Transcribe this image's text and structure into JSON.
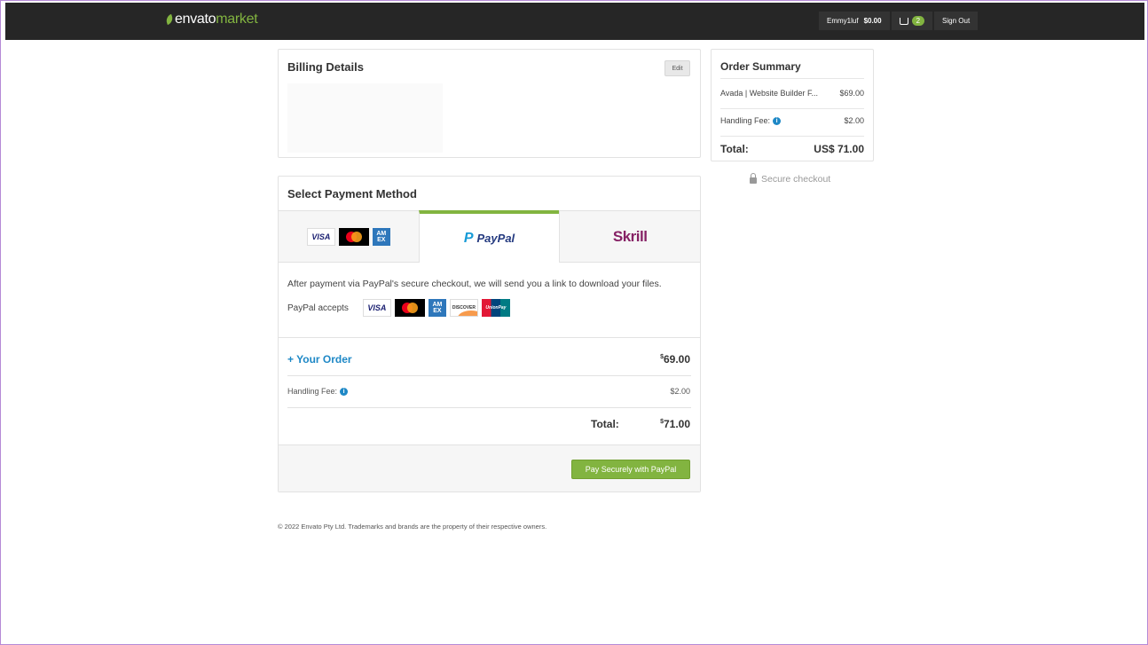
{
  "header": {
    "logo_brand": "envato",
    "logo_market": "market",
    "username": "Emmy1luf",
    "balance": "$0.00",
    "cart_count": "2",
    "signout_label": "Sign Out"
  },
  "billing": {
    "title": "Billing Details",
    "edit_label": "Edit"
  },
  "payment": {
    "title": "Select Payment Method",
    "tabs": [
      {
        "id": "cards",
        "cards": [
          "VISA",
          "MasterCard",
          "AMEX"
        ]
      },
      {
        "id": "paypal",
        "label": "PayPal",
        "active": true
      },
      {
        "id": "skrill",
        "label": "Skrill"
      }
    ],
    "paypal_info": "After payment via PayPal's secure checkout, we will send you a link to download your files.",
    "paypal_accepts_label": "PayPal accepts",
    "accepted_cards": [
      "VISA",
      "MasterCard",
      "AMEX",
      "DISCOVER",
      "UnionPay"
    ],
    "your_order_label": "+ Your Order",
    "your_order_currency": "$",
    "your_order_price": "69.00",
    "handling_fee_label": "Handling Fee:",
    "handling_fee_value": "$2.00",
    "total_label": "Total:",
    "total_currency": "$",
    "total_value": "71.00",
    "pay_button_label": "Pay Securely with PayPal"
  },
  "summary": {
    "title": "Order Summary",
    "item_name": "Avada | Website Builder F...",
    "item_price": "$69.00",
    "handling_fee_label": "Handling Fee:",
    "handling_fee_value": "$2.00",
    "total_label": "Total:",
    "total_value": "US$ 71.00"
  },
  "secure_checkout_label": "Secure checkout",
  "footer_text": "© 2022 Envato Pty Ltd. Trademarks and brands are the property of their respective owners.",
  "colors": {
    "accent_green": "#82b440",
    "link_blue": "#1e88c6",
    "topbar": "#262626",
    "skrill": "#862165",
    "paypal_dark": "#253b80"
  }
}
